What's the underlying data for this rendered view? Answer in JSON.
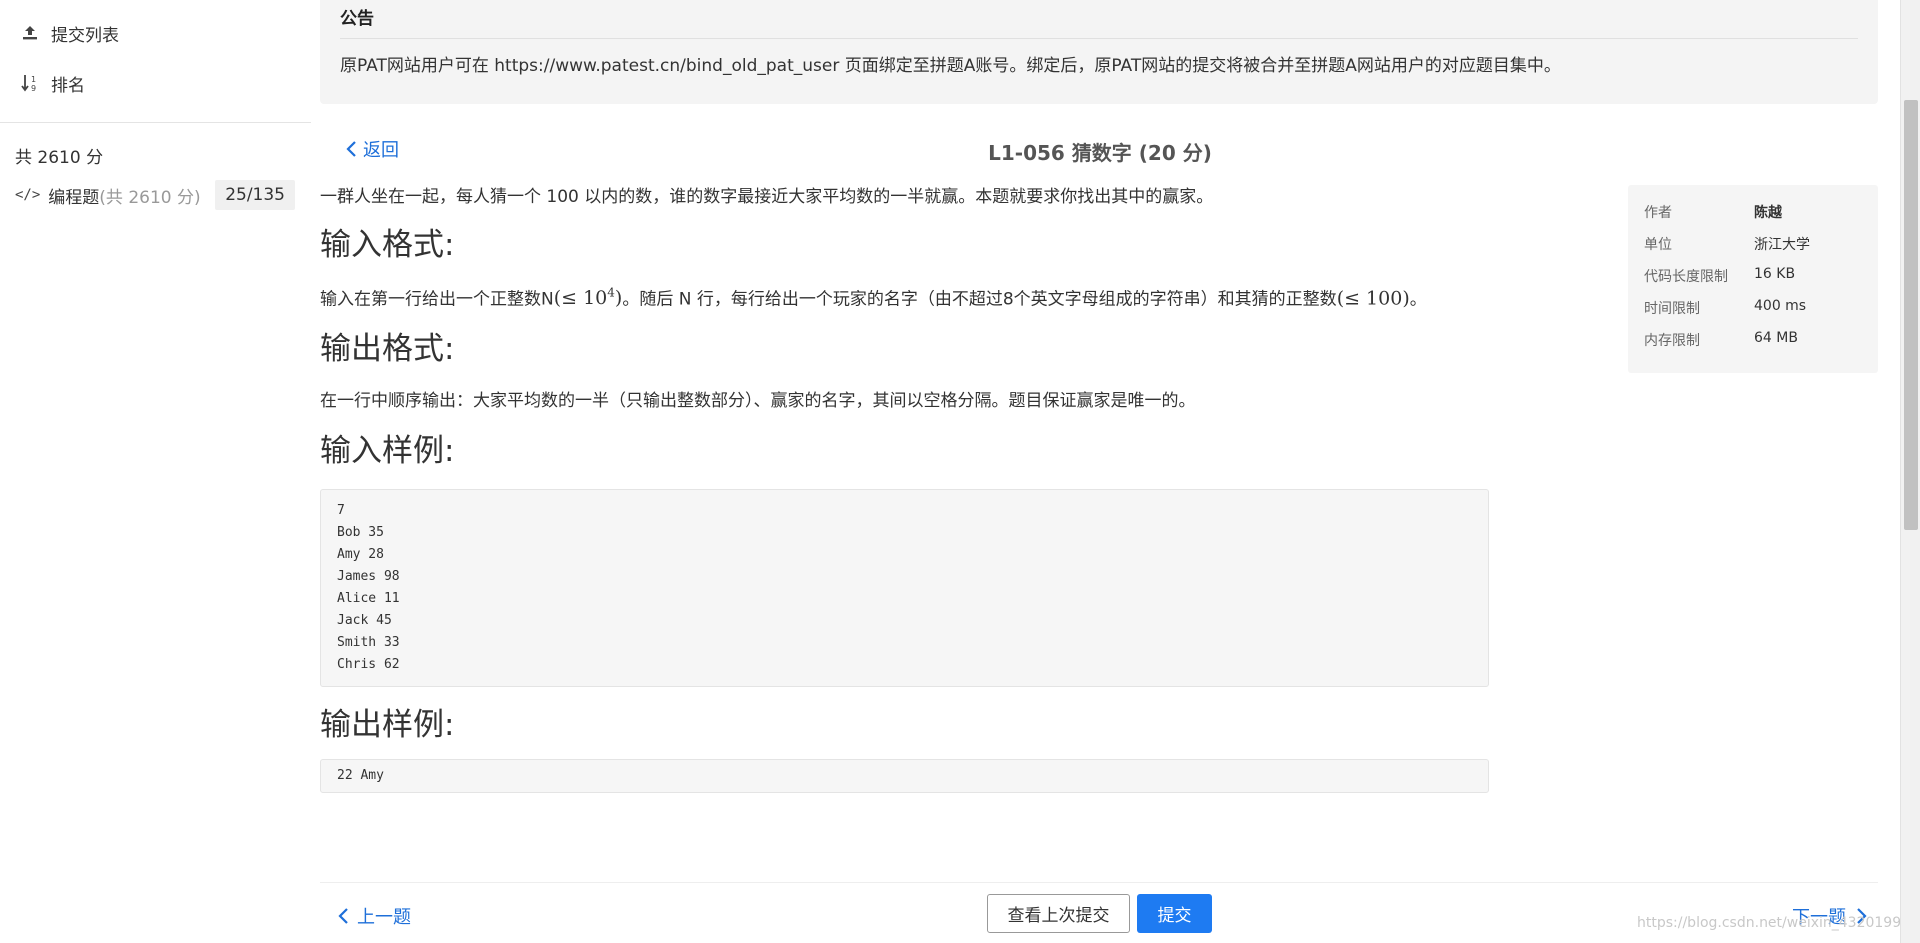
{
  "sidebar": {
    "nav_items": [
      {
        "label": "提交列表",
        "icon": "upload-icon"
      },
      {
        "label": "排名",
        "icon": "sort-icon"
      }
    ],
    "score_total": "共 2610 分",
    "category": {
      "label": "编程题",
      "detail": "(共 2610 分)",
      "count": "25/135",
      "icon": "code-icon"
    }
  },
  "announcement": {
    "title": "公告",
    "text": "原PAT网站用户可在 https://www.patest.cn/bind_old_pat_user 页面绑定至拼题A账号。绑定后，原PAT网站的提交将被合并至拼题A网站用户的对应题目集中。"
  },
  "problem": {
    "back_label": "返回",
    "title": "L1-056 猜数字 (20 分)",
    "description": "一群人坐在一起，每人猜一个 100 以内的数，谁的数字最接近大家平均数的一半就赢。本题就要求你找出其中的赢家。",
    "input_heading": "输入格式:",
    "input_text_1": "输入在第一行给出一个正整数N",
    "input_math_1": "(≤ 10",
    "input_math_1_sup": "4",
    "input_math_1_end": ")",
    "input_text_2": "。随后 N 行，每行给出一个玩家的名字（由不超过8个英文字母组成的字符串）和其猜的正整数",
    "input_math_2": "(≤ 100)",
    "input_text_3": "。",
    "output_heading": "输出格式:",
    "output_text": "在一行中顺序输出：大家平均数的一半（只输出整数部分）、赢家的名字，其间以空格分隔。题目保证赢家是唯一的。",
    "sample_input_heading": "输入样例:",
    "sample_input_lines": [
      "7",
      "Bob 35",
      "Amy 28",
      "James 98",
      "Alice 11",
      "Jack 45",
      "Smith 33",
      "Chris 62"
    ],
    "sample_output_heading": "输出样例:",
    "sample_output_lines": [
      "22 Amy"
    ]
  },
  "info_panel": [
    {
      "key": "作者",
      "value": "陈越"
    },
    {
      "key": "单位",
      "value": "浙江大学"
    },
    {
      "key": "代码长度限制",
      "value": "16 KB"
    },
    {
      "key": "时间限制",
      "value": "400 ms"
    },
    {
      "key": "内存限制",
      "value": "64 MB"
    }
  ],
  "bottom_bar": {
    "prev_label": "上一题",
    "history_label": "查看上次提交",
    "submit_label": "提交",
    "next_label": "下一题"
  },
  "watermark": "https://blog.csdn.net/weixin_43201995",
  "colors": {
    "accent": "#1e7bf2",
    "link": "#1e6fd9"
  }
}
